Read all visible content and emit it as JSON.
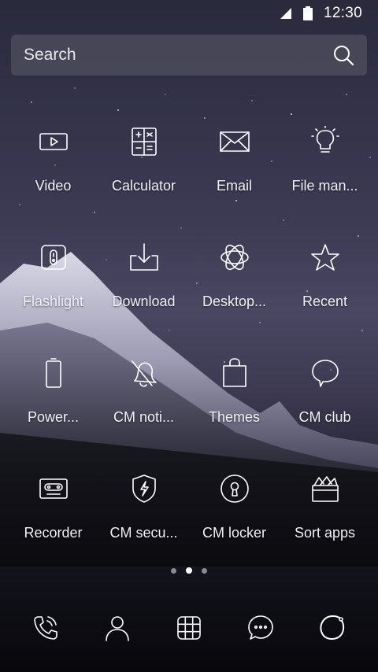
{
  "status_bar": {
    "time": "12:30"
  },
  "search": {
    "placeholder": "Search"
  },
  "apps": [
    [
      {
        "label": "Video",
        "icon": "video-icon"
      },
      {
        "label": "Calculator",
        "icon": "calculator-icon"
      },
      {
        "label": "Email",
        "icon": "email-icon"
      },
      {
        "label": "File man...",
        "icon": "lightbulb-icon"
      }
    ],
    [
      {
        "label": "Flashlight",
        "icon": "flashlight-icon"
      },
      {
        "label": "Download",
        "icon": "download-icon"
      },
      {
        "label": "Desktop...",
        "icon": "atom-icon"
      },
      {
        "label": "Recent",
        "icon": "star-icon"
      }
    ],
    [
      {
        "label": "Power...",
        "icon": "battery-icon"
      },
      {
        "label": "CM noti...",
        "icon": "bell-icon"
      },
      {
        "label": "Themes",
        "icon": "shopping-bag-icon"
      },
      {
        "label": "CM club",
        "icon": "chat-bubble-icon"
      }
    ],
    [
      {
        "label": "Recorder",
        "icon": "cassette-icon"
      },
      {
        "label": "CM secu...",
        "icon": "shield-icon"
      },
      {
        "label": "CM locker",
        "icon": "lock-icon"
      },
      {
        "label": "Sort apps",
        "icon": "sort-box-icon"
      }
    ]
  ],
  "pager": {
    "pages": 3,
    "active": 2
  },
  "dock": [
    "phone-icon",
    "contacts-icon",
    "app-drawer-icon",
    "messages-icon",
    "browser-icon"
  ]
}
